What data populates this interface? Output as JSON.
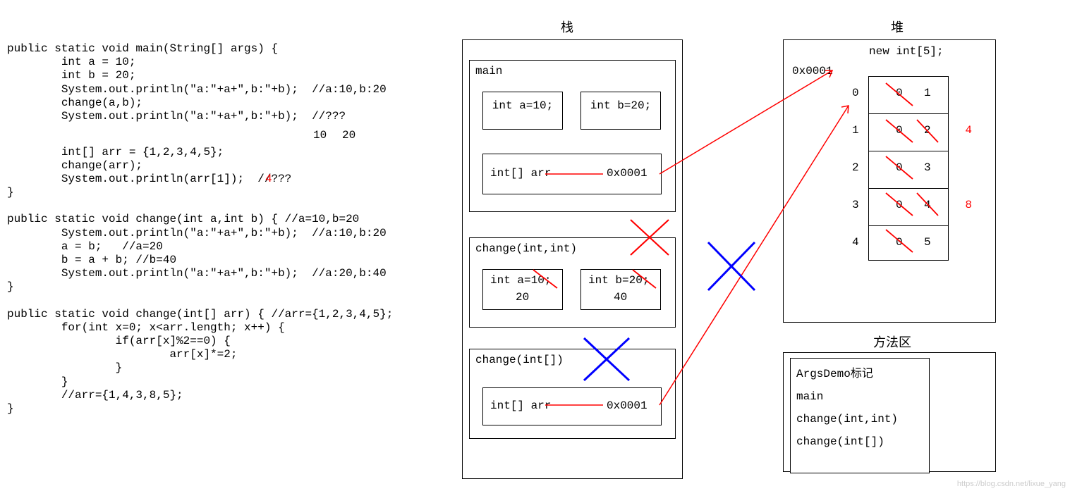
{
  "code": {
    "main": "public static void main(String[] args) {\n        int a = 10;\n        int b = 20;\n        System.out.println(\"a:\"+a+\",b:\"+b);  //a:10,b:20\n        change(a,b);\n        System.out.println(\"a:\"+a+\",b:\"+b);  //???",
    "ans1_10": "10",
    "ans1_20": "20",
    "main2": "        int[] arr = {1,2,3,4,5};\n        change(arr);\n        System.out.println(arr[1]);  //??? ",
    "ans2_4": "4",
    "main3": "}\n\npublic static void change(int a,int b) { //a=10,b=20\n        System.out.println(\"a:\"+a+\",b:\"+b);  //a:10,b:20\n        a = b;   //a=20\n        b = a + b; //b=40\n        System.out.println(\"a:\"+a+\",b:\"+b);  //a:20,b:40\n}\n\npublic static void change(int[] arr) { //arr={1,2,3,4,5};\n        for(int x=0; x<arr.length; x++) {\n                if(arr[x]%2==0) {\n                        arr[x]*=2;\n                }\n        }\n        //arr={1,4,3,8,5};\n}"
  },
  "titles": {
    "stack": "栈",
    "heap": "堆",
    "method_area": "方法区",
    "new_int": "new int[5];"
  },
  "stack": {
    "frame1": {
      "name": "main",
      "v1": "int a=10;",
      "v2": "int b=20;",
      "arr": "int[] arr",
      "addr": "0x0001"
    },
    "frame2": {
      "name": "change(int,int)",
      "v1": "int a=10;",
      "v1b": "20",
      "v2": "int b=20;",
      "v2b": "40"
    },
    "frame3": {
      "name": "change(int[])",
      "arr": "int[] arr",
      "addr": "0x0001"
    }
  },
  "heap": {
    "addr": "0x0001",
    "rows": [
      {
        "idx": "0",
        "zero": "0",
        "val": "1",
        "red": ""
      },
      {
        "idx": "1",
        "zero": "0",
        "val": "2",
        "red": "4"
      },
      {
        "idx": "2",
        "zero": "0",
        "val": "3",
        "red": ""
      },
      {
        "idx": "3",
        "zero": "0",
        "val": "4",
        "red": "8"
      },
      {
        "idx": "4",
        "zero": "0",
        "val": "5",
        "red": ""
      }
    ]
  },
  "method_area": {
    "cls": "ArgsDemo标记",
    "m1": "main",
    "m2": "change(int,int)",
    "m3": "change(int[])"
  },
  "watermark": "https://blog.csdn.net/lixue_yang"
}
